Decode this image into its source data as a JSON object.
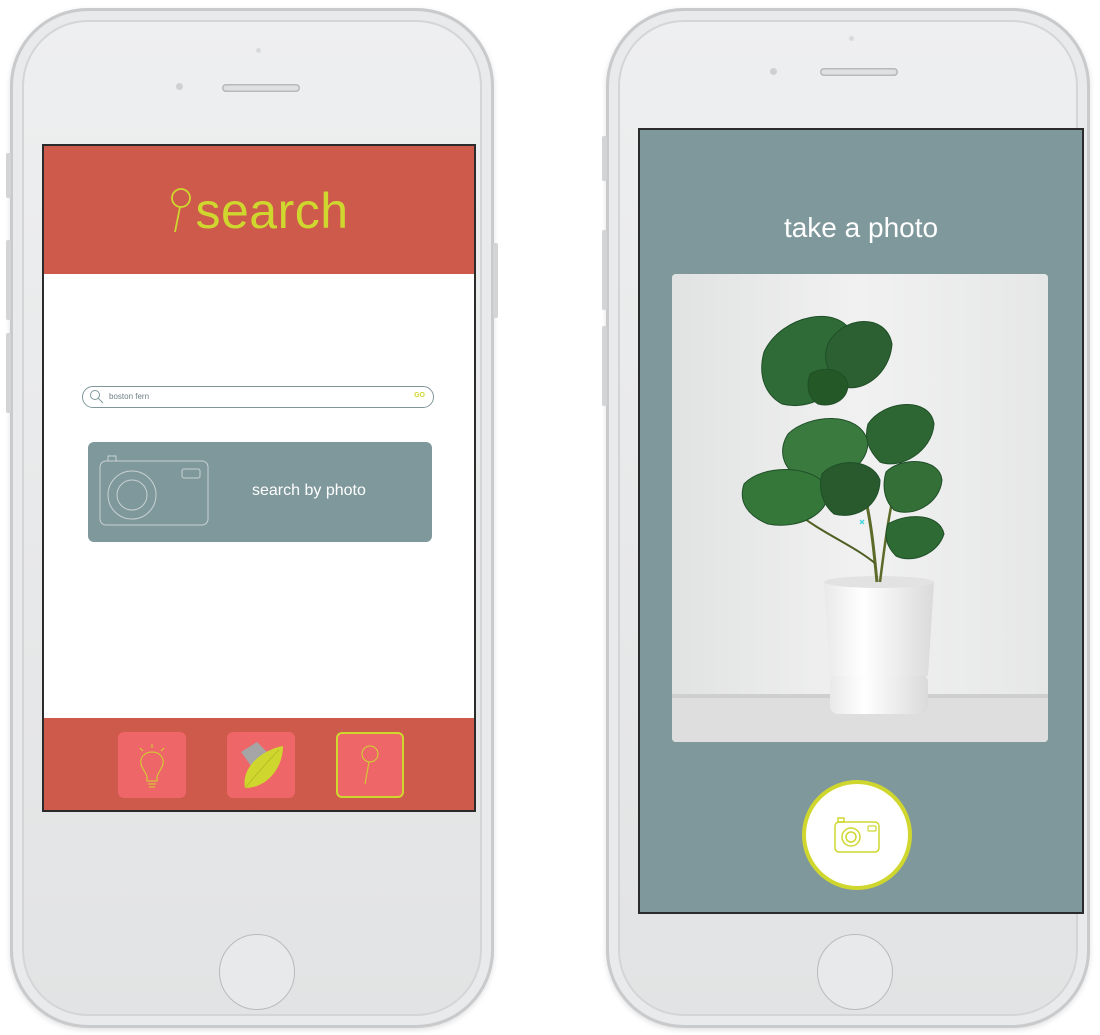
{
  "colors": {
    "coral": "#cd5a4a",
    "tab_pink": "#ee6668",
    "lime": "#cfd72f",
    "slate_teal": "#7f989b",
    "white": "#ffffff"
  },
  "left_screen": {
    "header": {
      "title": "search",
      "icon": "map-pin-icon"
    },
    "search_bar": {
      "value": "boston fern",
      "go_label": "GO",
      "icon": "search-icon"
    },
    "photo_search_button": {
      "label": "search by photo",
      "icon": "camera-icon"
    },
    "tabbar": {
      "items": [
        {
          "name": "ideas",
          "icon": "lightbulb-icon",
          "active": false
        },
        {
          "name": "plants",
          "icon": "leaf-icon",
          "active": false
        },
        {
          "name": "search",
          "icon": "map-pin-icon",
          "active": true
        }
      ]
    }
  },
  "right_screen": {
    "title": "take a photo",
    "preview_subject": "potted fiddle leaf fig",
    "shutter_icon": "camera-icon"
  }
}
